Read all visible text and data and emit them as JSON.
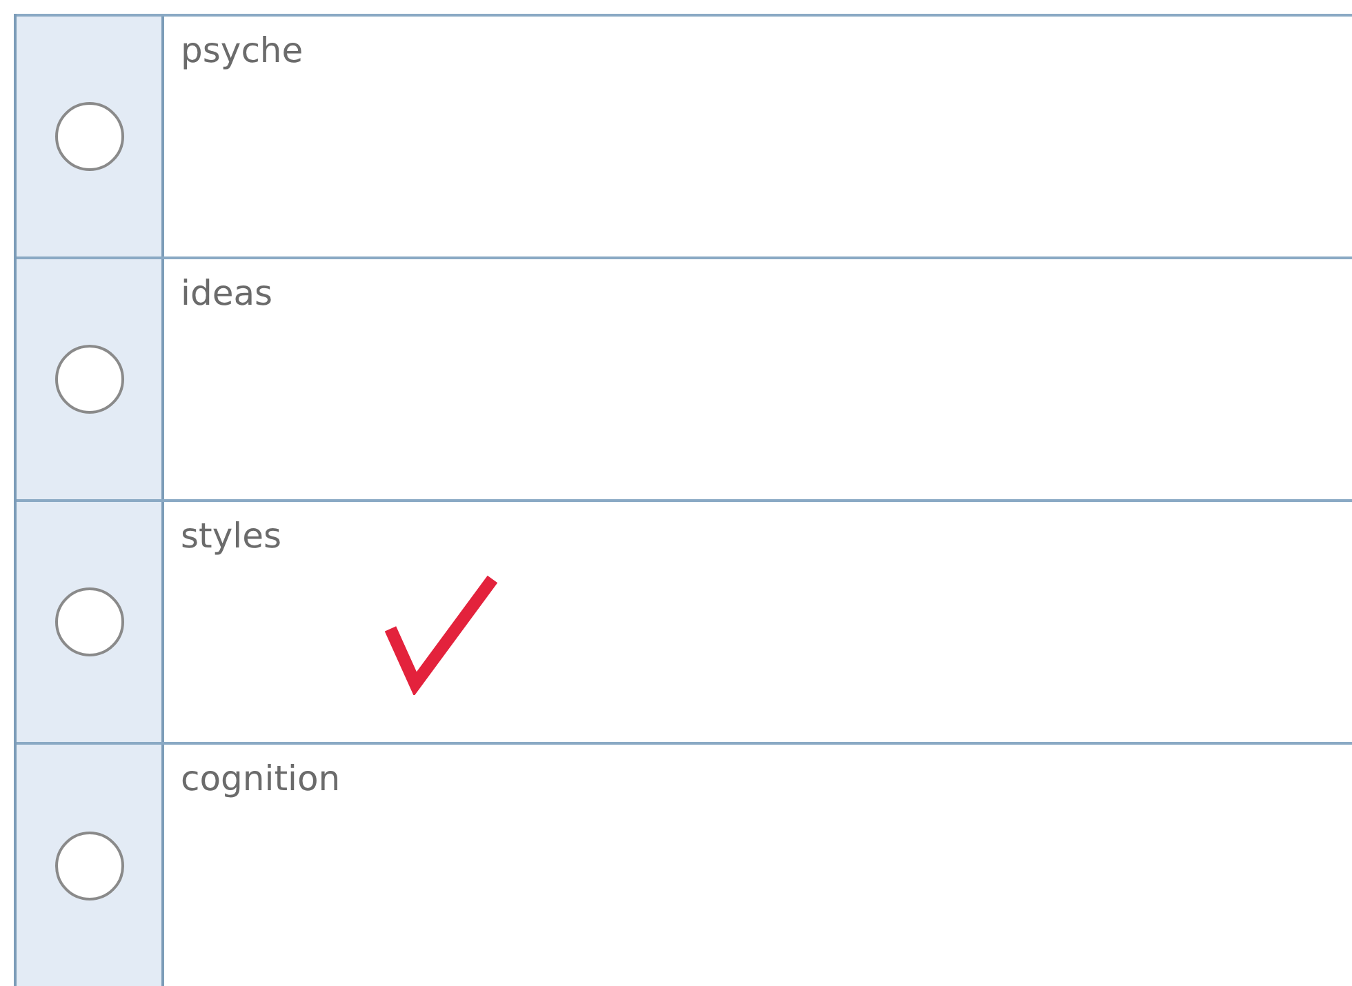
{
  "options": [
    {
      "label": "psyche",
      "selected": false,
      "marked": false
    },
    {
      "label": "ideas",
      "selected": false,
      "marked": false
    },
    {
      "label": "styles",
      "selected": false,
      "marked": true
    },
    {
      "label": "cognition",
      "selected": false,
      "marked": false
    }
  ]
}
